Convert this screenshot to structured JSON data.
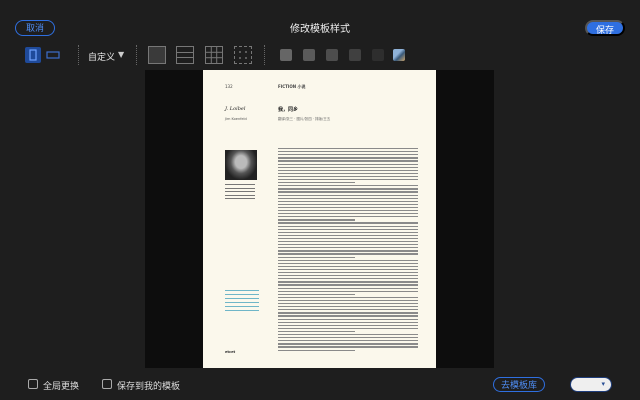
{
  "header": {
    "cancel_label": "取消",
    "title": "修改模板样式",
    "save_label": "保存"
  },
  "toolbar": {
    "preset_label": "自定义",
    "preset_arrow": "▼",
    "swatches": [
      "#666666",
      "#5a5a5a",
      "#4d4d4d",
      "#404040",
      "#2e2e2e"
    ]
  },
  "page": {
    "page_number": "132",
    "section": "FICTION 小说",
    "author": "J. Loibel",
    "author_sub": "Jim Koenfeld",
    "article_title": "我，同乡",
    "article_sub": "翻译/张三 · 图片/张四 · 排版/王五",
    "footer": "etcet"
  },
  "bottom": {
    "global_replace_label": "全局更换",
    "save_to_my_templates_label": "保存到我的模板",
    "template_library_label": "去模板库",
    "disabled_button_label": "▾"
  }
}
